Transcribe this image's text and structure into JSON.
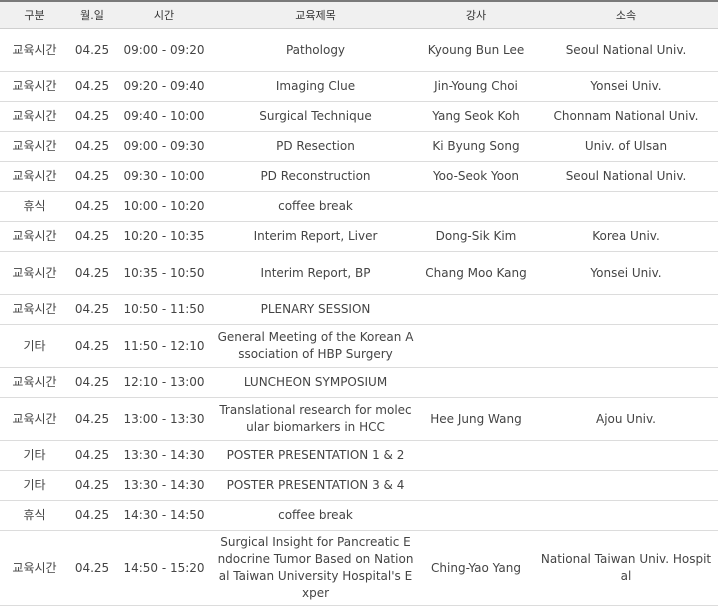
{
  "columns": [
    "구분",
    "월.일",
    "시간",
    "교육제목",
    "강사",
    "소속"
  ],
  "rows": [
    {
      "category": "교육시간",
      "date": "04.25",
      "time": "09:00 - 09:20",
      "title": "Pathology",
      "speaker": "Kyoung Bun Lee",
      "affiliation": "Seoul National Univ."
    },
    {
      "category": "교육시간",
      "date": "04.25",
      "time": "09:20 - 09:40",
      "title": "Imaging Clue",
      "speaker": "Jin-Young Choi",
      "affiliation": "Yonsei Univ."
    },
    {
      "category": "교육시간",
      "date": "04.25",
      "time": "09:40 - 10:00",
      "title": "Surgical Technique",
      "speaker": "Yang Seok Koh",
      "affiliation": "Chonnam National Univ."
    },
    {
      "category": "교육시간",
      "date": "04.25",
      "time": "09:00 - 09:30",
      "title": "PD Resection",
      "speaker": "Ki Byung Song",
      "affiliation": "Univ. of Ulsan"
    },
    {
      "category": "교육시간",
      "date": "04.25",
      "time": "09:30 - 10:00",
      "title": "PD Reconstruction",
      "speaker": "Yoo-Seok Yoon",
      "affiliation": "Seoul National Univ."
    },
    {
      "category": "휴식",
      "date": "04.25",
      "time": "10:00 - 10:20",
      "title": "coffee break",
      "speaker": "",
      "affiliation": ""
    },
    {
      "category": "교육시간",
      "date": "04.25",
      "time": "10:20 - 10:35",
      "title": "Interim Report, Liver",
      "speaker": "Dong-Sik Kim",
      "affiliation": "Korea Univ."
    },
    {
      "category": "교육시간",
      "date": "04.25",
      "time": "10:35 - 10:50",
      "title": "Interim Report, BP",
      "speaker": "Chang Moo Kang",
      "affiliation": "Yonsei Univ."
    },
    {
      "category": "교육시간",
      "date": "04.25",
      "time": "10:50 - 11:50",
      "title": "PLENARY SESSION",
      "speaker": "",
      "affiliation": ""
    },
    {
      "category": "기타",
      "date": "04.25",
      "time": "11:50 - 12:10",
      "title": "General Meeting of the Korean Association of HBP Surgery",
      "speaker": "",
      "affiliation": ""
    },
    {
      "category": "교육시간",
      "date": "04.25",
      "time": "12:10 - 13:00",
      "title": "LUNCHEON SYMPOSIUM",
      "speaker": "",
      "affiliation": ""
    },
    {
      "category": "교육시간",
      "date": "04.25",
      "time": "13:00 - 13:30",
      "title": "Translational research for molecular biomarkers in HCC",
      "speaker": "Hee Jung Wang",
      "affiliation": "Ajou Univ."
    },
    {
      "category": "기타",
      "date": "04.25",
      "time": "13:30 - 14:30",
      "title": "POSTER PRESENTATION 1 & 2",
      "speaker": "",
      "affiliation": ""
    },
    {
      "category": "기타",
      "date": "04.25",
      "time": "13:30 - 14:30",
      "title": "POSTER PRESENTATION 3 & 4",
      "speaker": "",
      "affiliation": ""
    },
    {
      "category": "휴식",
      "date": "04.25",
      "time": "14:30 - 14:50",
      "title": "coffee break",
      "speaker": "",
      "affiliation": ""
    },
    {
      "category": "교육시간",
      "date": "04.25",
      "time": "14:50 - 15:20",
      "title": "Surgical Insight for Pancreatic Endocrine Tumor Based on National Taiwan University Hospital's Exper",
      "speaker": "Ching-Yao Yang",
      "affiliation": "National Taiwan Univ. Hospital"
    }
  ]
}
